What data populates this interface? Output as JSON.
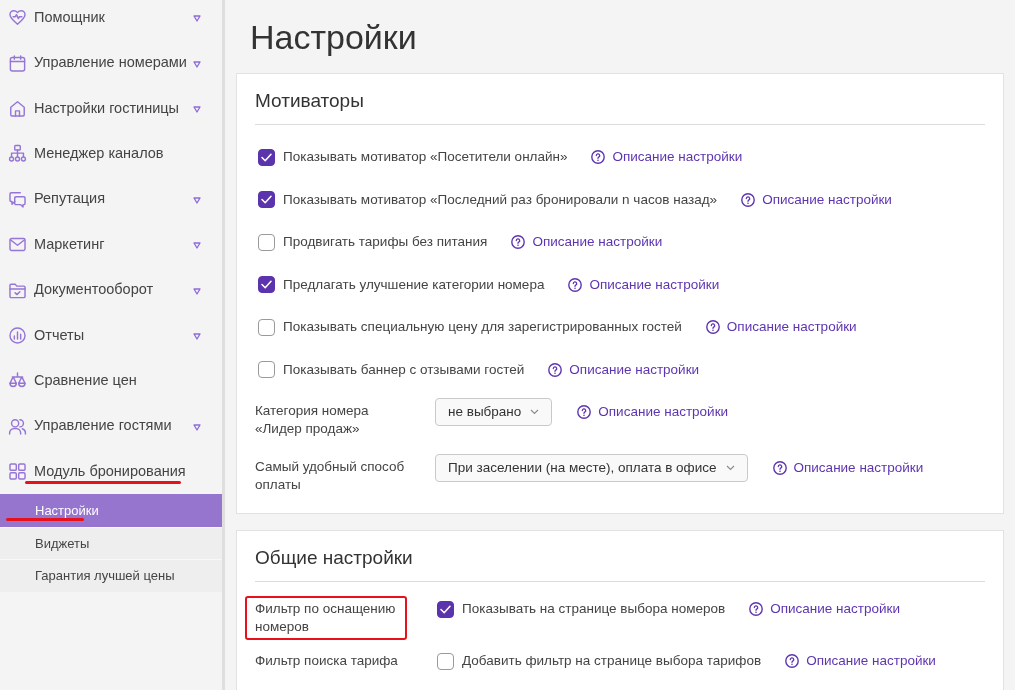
{
  "sidebar": {
    "items": [
      {
        "label": "Помощник",
        "expandable": true,
        "highlighted": false
      },
      {
        "label": "Управление номерами",
        "expandable": true,
        "highlighted": false
      },
      {
        "label": "Настройки гостиницы",
        "expandable": true,
        "highlighted": false
      },
      {
        "label": "Менеджер каналов",
        "expandable": false,
        "highlighted": false
      },
      {
        "label": "Репутация",
        "expandable": true,
        "highlighted": false
      },
      {
        "label": "Маркетинг",
        "expandable": true,
        "highlighted": false
      },
      {
        "label": "Документооборот",
        "expandable": true,
        "highlighted": false
      },
      {
        "label": "Отчеты",
        "expandable": true,
        "highlighted": false
      },
      {
        "label": "Сравнение цен",
        "expandable": false,
        "highlighted": false
      },
      {
        "label": "Управление гостями",
        "expandable": true,
        "highlighted": false
      },
      {
        "label": "Модуль бронирования",
        "expandable": false,
        "highlighted": true,
        "children": [
          {
            "label": "Настройки",
            "selected": true,
            "highlighted": true
          },
          {
            "label": "Виджеты",
            "selected": false,
            "highlighted": false
          },
          {
            "label": "Гарантия лучшей цены",
            "selected": false,
            "highlighted": false
          }
        ]
      }
    ]
  },
  "page_title": "Настройки",
  "sections": [
    {
      "title": "Мотиваторы",
      "rows": [
        {
          "kind": "checkbox",
          "label": "Показывать мотиватор «Посетители онлайн»",
          "checked": true,
          "help_link": "Описание настройки"
        },
        {
          "kind": "checkbox",
          "label": "Показывать мотиватор «Последний раз бронировали n часов назад»",
          "checked": true,
          "help_link": "Описание настройки"
        },
        {
          "kind": "checkbox",
          "label": "Продвигать тарифы без питания",
          "checked": false,
          "help_link": "Описание настройки"
        },
        {
          "kind": "checkbox",
          "label": "Предлагать улучшение категории номера",
          "checked": true,
          "help_link": "Описание настройки"
        },
        {
          "kind": "checkbox",
          "label": "Показывать специальную цену для зарегистрированных гостей",
          "checked": false,
          "help_link": "Описание настройки"
        },
        {
          "kind": "checkbox",
          "label": "Показывать баннер с отзывами гостей",
          "checked": false,
          "help_link": "Описание настройки"
        },
        {
          "kind": "select",
          "label": "Категория номера «Лидер продаж»",
          "value": "не выбрано",
          "help_link": "Описание настройки"
        },
        {
          "kind": "select",
          "label": "Самый удобный способ оплаты",
          "value": "При заселении (на месте), оплата в офисе",
          "help_link": "Описание настройки"
        }
      ]
    },
    {
      "title": "Общие настройки",
      "rows": [
        {
          "kind": "labeled_checkbox",
          "label": "Фильтр по оснащению номеров",
          "highlighted": true,
          "checkbox_label": "Показывать на странице выбора номеров",
          "checked": true,
          "help_link": "Описание настройки"
        },
        {
          "kind": "labeled_checkbox",
          "label": "Фильтр поиска тарифа",
          "highlighted": false,
          "checkbox_label": "Добавить фильтр на странице выбора тарифов",
          "checked": false,
          "help_link": "Описание настройки"
        }
      ]
    }
  ]
}
